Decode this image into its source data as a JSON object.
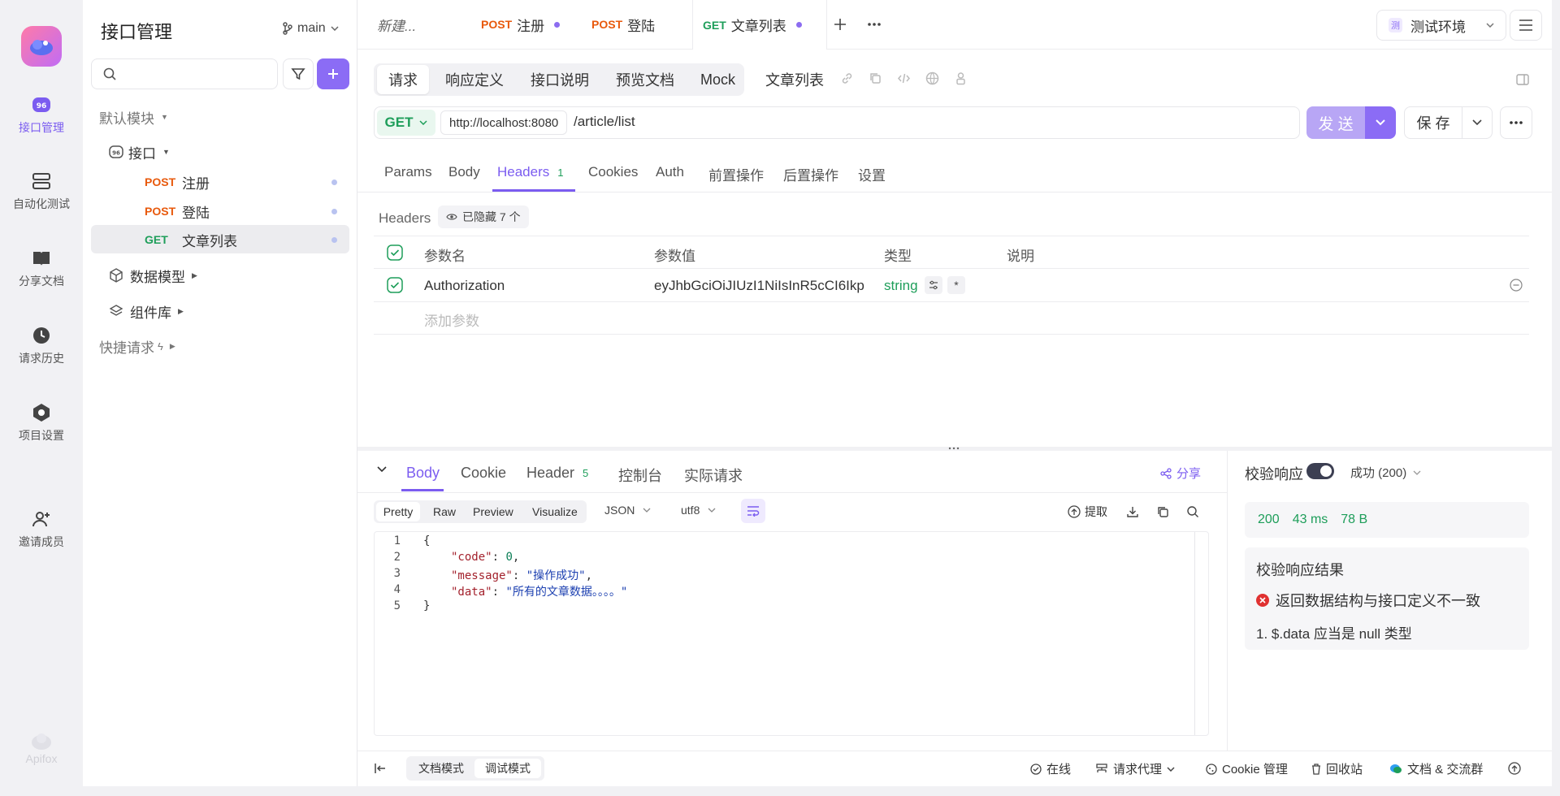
{
  "app": {
    "brand": "Apifox"
  },
  "rail": [
    {
      "label": "接口管理",
      "icon": "api-management-icon",
      "active": true
    },
    {
      "label": "自动化测试",
      "icon": "automation-test-icon"
    },
    {
      "label": "分享文档",
      "icon": "share-docs-icon"
    },
    {
      "label": "请求历史",
      "icon": "history-icon"
    },
    {
      "label": "项目设置",
      "icon": "settings-icon"
    },
    {
      "label": "邀请成员",
      "icon": "invite-member-icon"
    }
  ],
  "sidebar": {
    "title": "接口管理",
    "branch": "main",
    "search_placeholder": "",
    "default_module": "默认模块",
    "folder": "接口",
    "items": [
      {
        "method": "POST",
        "name": "注册"
      },
      {
        "method": "POST",
        "name": "登陆"
      },
      {
        "method": "GET",
        "name": "文章列表"
      }
    ],
    "data_model": "数据模型",
    "components": "组件库",
    "quick_request": "快捷请求"
  },
  "tabs": [
    {
      "label": "新建..."
    },
    {
      "method": "POST",
      "label": "注册"
    },
    {
      "method": "POST",
      "label": "登陆"
    },
    {
      "method": "GET",
      "label": "文章列表"
    }
  ],
  "env": {
    "badge": "测",
    "label": "测试环境"
  },
  "segments": [
    "请求",
    "响应定义",
    "接口说明",
    "预览文档",
    "Mock"
  ],
  "endpoint_name": "文章列表",
  "request": {
    "method": "GET",
    "base_url": "http://localhost:8080",
    "path": "/article/list",
    "send_label": "发 送",
    "save_label": "保 存"
  },
  "req_tabs": [
    "Params",
    "Body",
    "Headers",
    "Cookies",
    "Auth",
    "前置操作",
    "后置操作",
    "设置"
  ],
  "headers_count": "1",
  "headers_section": {
    "label": "Headers",
    "hidden": "已隐藏 7 个"
  },
  "table": {
    "columns": [
      "参数名",
      "参数值",
      "类型",
      "说明"
    ],
    "rows": [
      {
        "name": "Authorization",
        "value": "eyJhbGciOiJIUzI1NiIsInR5cCI6Ikp",
        "type": "string"
      }
    ],
    "add_placeholder": "添加参数"
  },
  "resp_tabs": [
    "Body",
    "Cookie",
    "Header",
    "控制台",
    "实际请求"
  ],
  "resp_header_count": "5",
  "share_label": "分享",
  "view_modes": [
    "Pretty",
    "Raw",
    "Preview",
    "Visualize"
  ],
  "format": "JSON",
  "encoding": "utf8",
  "extract_label": "提取",
  "code_lines": [
    "1",
    "2",
    "3",
    "4",
    "5"
  ],
  "code": {
    "open": "{",
    "code_key": "\"code\"",
    "code_val": "0",
    "msg_key": "\"message\"",
    "msg_val": "\"操作成功\"",
    "data_key": "\"data\"",
    "data_val": "\"所有的文章数据。。。。\"",
    "close": "}"
  },
  "validate": {
    "label": "校验响应",
    "status_select": "成功 (200)",
    "status": "200",
    "time": "43 ms",
    "size": "78 B",
    "result_title": "校验响应结果",
    "error": "返回数据结构与接口定义不一致",
    "detail": "1. $.data 应当是 null 类型"
  },
  "bottom": {
    "doc_mode": "文档模式",
    "debug_mode": "调试模式",
    "online": "在线",
    "proxy": "请求代理",
    "cookie": "Cookie 管理",
    "recycle": "回收站",
    "community": "文档 & 交流群"
  },
  "colors": {
    "accent": "#7b5cf0",
    "post": "#e8590c",
    "get": "#1e9e5a",
    "error": "#e03131"
  }
}
